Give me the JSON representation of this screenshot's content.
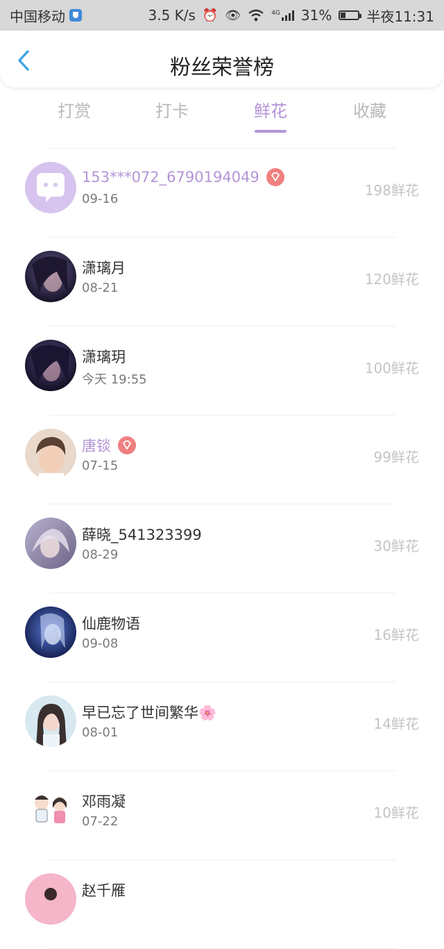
{
  "status_bar": {
    "carrier": "中国移动",
    "speed": "3.5 K/s",
    "network": "4G",
    "battery": "31%",
    "battery_level": 0.31,
    "time": "半夜11:31"
  },
  "header": {
    "title": "粉丝荣誉榜"
  },
  "tabs": [
    {
      "label": "打赏",
      "active": false
    },
    {
      "label": "打卡",
      "active": false
    },
    {
      "label": "鲜花",
      "active": true
    },
    {
      "label": "收藏",
      "active": false
    }
  ],
  "fans": [
    {
      "name": "153***072_6790194049",
      "date": "09-16",
      "amount": "198鲜花",
      "vip": true,
      "avatar": "default-chat-avatar"
    },
    {
      "name": "潇璃月",
      "date": "08-21",
      "amount": "120鲜花",
      "vip": false,
      "avatar": "dark-anime-avatar"
    },
    {
      "name": "潇璃玥",
      "date": "今天 19:55",
      "amount": "100鲜花",
      "vip": false,
      "avatar": "dark-anime-avatar"
    },
    {
      "name": "唐锬",
      "date": "07-15",
      "amount": "99鲜花",
      "vip": true,
      "avatar": "boy-photo-avatar"
    },
    {
      "name": "薛晓_541323399",
      "date": "08-29",
      "amount": "30鲜花",
      "vip": false,
      "avatar": "pastel-anime-avatar"
    },
    {
      "name": "仙鹿物语",
      "date": "09-08",
      "amount": "16鲜花",
      "vip": false,
      "avatar": "blue-anime-avatar"
    },
    {
      "name": "早已忘了世间繁华🌸",
      "date": "08-01",
      "amount": "14鲜花",
      "vip": false,
      "avatar": "girl-photo-avatar"
    },
    {
      "name": "邓雨凝",
      "date": "07-22",
      "amount": "10鲜花",
      "vip": false,
      "avatar": "couple-cartoon-avatar"
    },
    {
      "name": "赵千雁",
      "date": "",
      "amount": "",
      "vip": false,
      "avatar": "pink-avatar"
    }
  ],
  "colors": {
    "accent": "#b394d6",
    "back_icon": "#3da3e6",
    "vip_badge": "#f08080"
  }
}
